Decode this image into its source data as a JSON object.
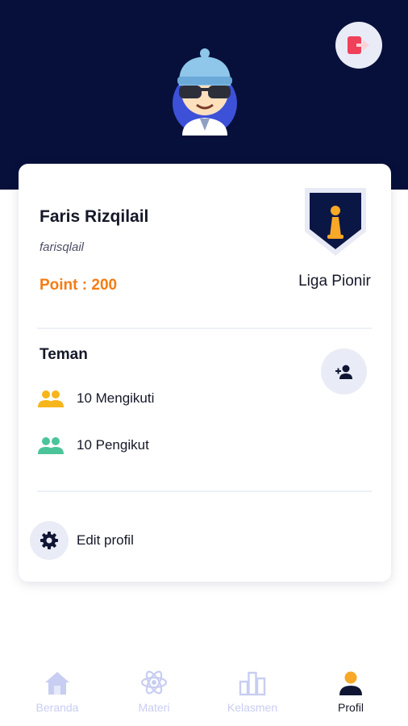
{
  "profile": {
    "name": "Faris Rizqilail",
    "username": "farisqlail",
    "points": "Point : 200",
    "league": "Liga Pionir"
  },
  "friends": {
    "title": "Teman",
    "following": "10 Mengikuti",
    "followers": "10 Pengikut"
  },
  "settings": {
    "edit_profile": "Edit profil"
  },
  "nav": {
    "items": [
      {
        "label": "Beranda",
        "icon": "home-icon",
        "active": false
      },
      {
        "label": "Materi",
        "icon": "atom-icon",
        "active": false
      },
      {
        "label": "Kelasmen",
        "icon": "leaderboard-icon",
        "active": false
      },
      {
        "label": "Profil",
        "icon": "person-icon",
        "active": true
      }
    ]
  },
  "colors": {
    "header": "#06103a",
    "points": "#f57c14",
    "logout_icon": "#f0405a",
    "following_icon": "#f7b51c",
    "followers_icon": "#4cc49a",
    "nav_inactive": "#c8cdf2",
    "nav_active": "#151828"
  }
}
